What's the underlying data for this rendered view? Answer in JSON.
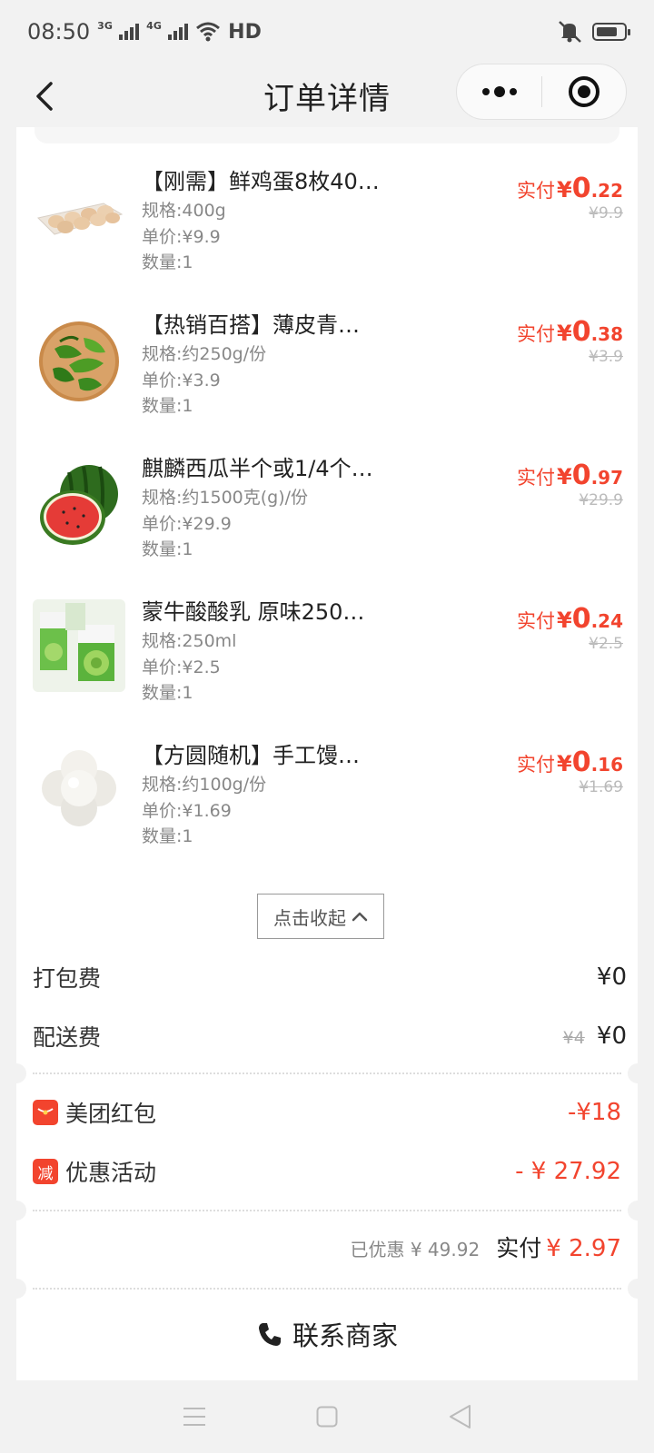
{
  "status_bar": {
    "time": "08:50",
    "net1": "3G",
    "net2": "4G",
    "hd": "HD"
  },
  "nav": {
    "title": "订单详情"
  },
  "items": [
    {
      "name": "【刚需】鲜鸡蛋8枚40…",
      "spec": "规格:400g",
      "unit_price": "单价:¥9.9",
      "qty": "数量:1",
      "pay_label": "实付",
      "currency": "¥",
      "pay_int": "0",
      "pay_dec": ".22",
      "orig": "¥9.9",
      "img": "egg-tray"
    },
    {
      "name": "【热销百搭】薄皮青…",
      "spec": "规格:约250g/份",
      "unit_price": "单价:¥3.9",
      "qty": "数量:1",
      "pay_label": "实付",
      "currency": "¥",
      "pay_int": "0",
      "pay_dec": ".38",
      "orig": "¥3.9",
      "img": "green-pepper"
    },
    {
      "name": "麒麟西瓜半个或1/4个…",
      "spec": "规格:约1500克(g)/份",
      "unit_price": "单价:¥29.9",
      "qty": "数量:1",
      "pay_label": "实付",
      "currency": "¥",
      "pay_int": "0",
      "pay_dec": ".97",
      "orig": "¥29.9",
      "img": "watermelon"
    },
    {
      "name": "蒙牛酸酸乳 原味250…",
      "spec": "规格:250ml",
      "unit_price": "单价:¥2.5",
      "qty": "数量:1",
      "pay_label": "实付",
      "currency": "¥",
      "pay_int": "0",
      "pay_dec": ".24",
      "orig": "¥2.5",
      "img": "yogurt-box"
    },
    {
      "name": "【方圆随机】手工馒…",
      "spec": "规格:约100g/份",
      "unit_price": "单价:¥1.69",
      "qty": "数量:1",
      "pay_label": "实付",
      "currency": "¥",
      "pay_int": "0",
      "pay_dec": ".16",
      "orig": "¥1.69",
      "img": "steamed-buns"
    }
  ],
  "collapse": {
    "label": "点击收起"
  },
  "fees": {
    "packing": {
      "label": "打包费",
      "value": "¥0"
    },
    "delivery": {
      "label": "配送费",
      "orig": "¥4",
      "value": "¥0"
    }
  },
  "discounts": {
    "redpacket": {
      "label": "美团红包",
      "value": "-¥18"
    },
    "promo": {
      "label": "优惠活动",
      "icon_text": "减",
      "value": "- ¥ 27.92"
    }
  },
  "total": {
    "saved": "已优惠 ¥ 49.92",
    "pay_label": "实付",
    "pay_value": "¥ 2.97"
  },
  "contact": {
    "label": "联系商家"
  },
  "colors": {
    "accent": "#f2442e",
    "background": "#f2f2f2"
  }
}
